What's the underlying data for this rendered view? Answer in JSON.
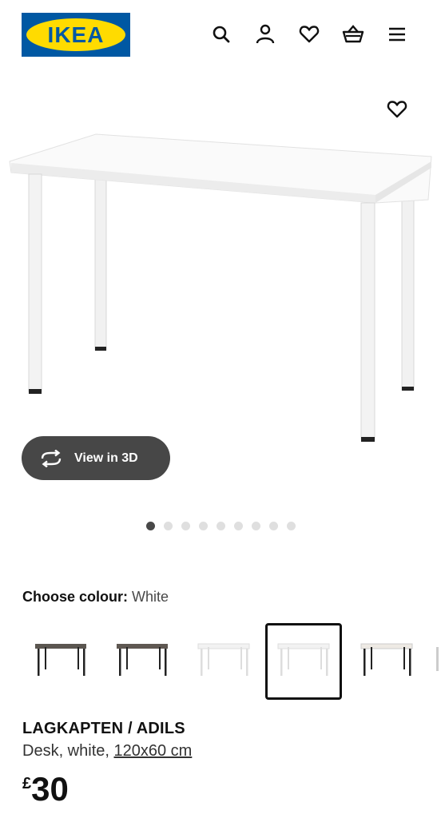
{
  "header": {
    "logo_text": "IKEA",
    "icons": [
      "search-icon",
      "account-icon",
      "heart-icon",
      "basket-icon",
      "menu-icon"
    ],
    "brand_blue": "#0058a3",
    "brand_yellow": "#ffdb00"
  },
  "gallery": {
    "view3d_label": "View in 3D",
    "slide_count": 9,
    "active_slide": 1
  },
  "colour": {
    "label": "Choose colour:",
    "value": "White",
    "options": [
      {
        "name": "dark-grey"
      },
      {
        "name": "dark-grey-2"
      },
      {
        "name": "white"
      },
      {
        "name": "white",
        "selected": true
      },
      {
        "name": "white-black"
      }
    ]
  },
  "product": {
    "name": "LAGKAPTEN / ADILS",
    "desc_prefix": "Desk, white, ",
    "size": "120x60 cm",
    "currency": "£",
    "price": "30"
  }
}
